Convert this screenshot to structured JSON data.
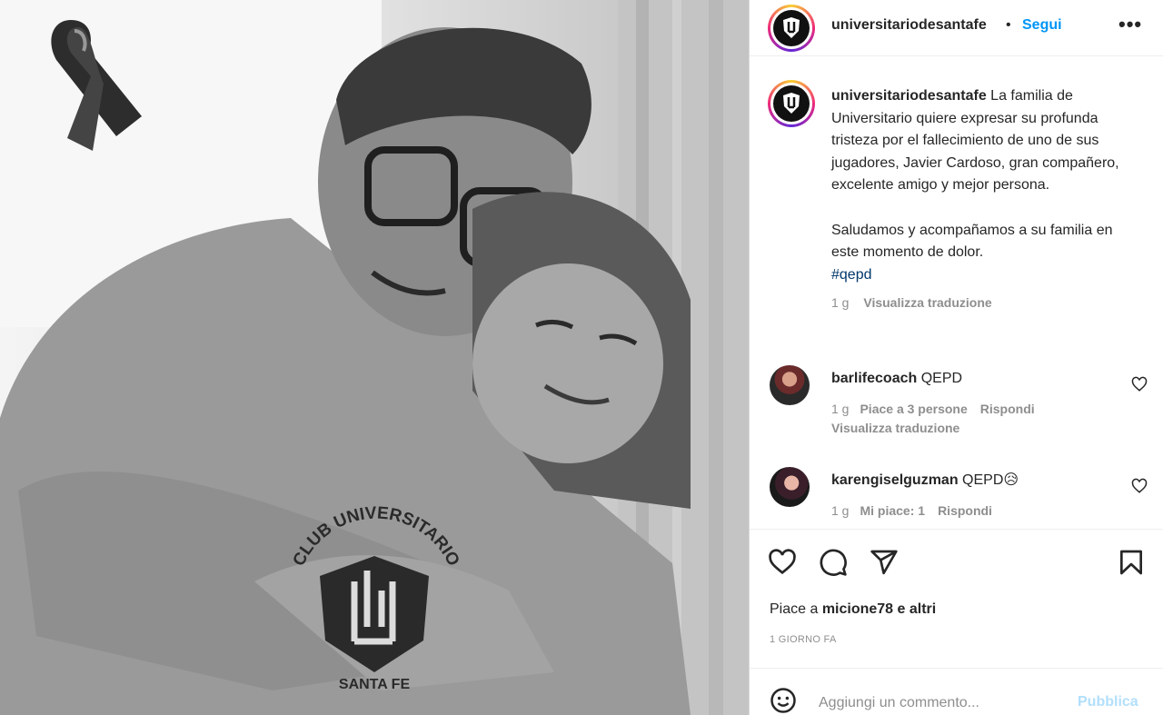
{
  "post": {
    "logo_arc_text": "CLUB UNIVERSITARIO",
    "logo_bottom_text": "SANTA FE"
  },
  "header": {
    "username": "universitariodesantafe",
    "separator": "•",
    "follow_label": "Segui",
    "more_label": "•••"
  },
  "caption": {
    "username": "universitariodesantafe",
    "text_part1": " La familia de Universitario quiere expresar su profunda tristeza por el fallecimiento de uno de sus jugadores, Javier Cardoso, gran compañero, excelente amigo y mejor persona.",
    "text_part2": "Saludamos y acompañamos a su familia en este momento de dolor.",
    "hashtag": "#qepd",
    "time": "1 g",
    "translate_label": "Visualizza traduzione"
  },
  "comments": [
    {
      "username": "barlifecoach",
      "text": " QEPD",
      "time": "1 g",
      "likes": "Piace a 3 persone",
      "reply_label": "Rispondi",
      "translate_label": "Visualizza traduzione"
    },
    {
      "username": "karengiselguzman",
      "text": " QEPD😥",
      "time": "1 g",
      "likes": "Mi piace: 1",
      "reply_label": "Rispondi"
    }
  ],
  "actions": {
    "likes_prefix": "Piace a ",
    "likes_user": "micione78",
    "likes_suffix": " e altri",
    "time_ago": "1 GIORNO FA"
  },
  "add_comment": {
    "placeholder": "Aggiungi un commento...",
    "publish_label": "Pubblica"
  },
  "colors": {
    "accent": "#0095f6",
    "publish_disabled": "#b2dffc",
    "muted": "#8e8e8e",
    "text": "#262626"
  }
}
